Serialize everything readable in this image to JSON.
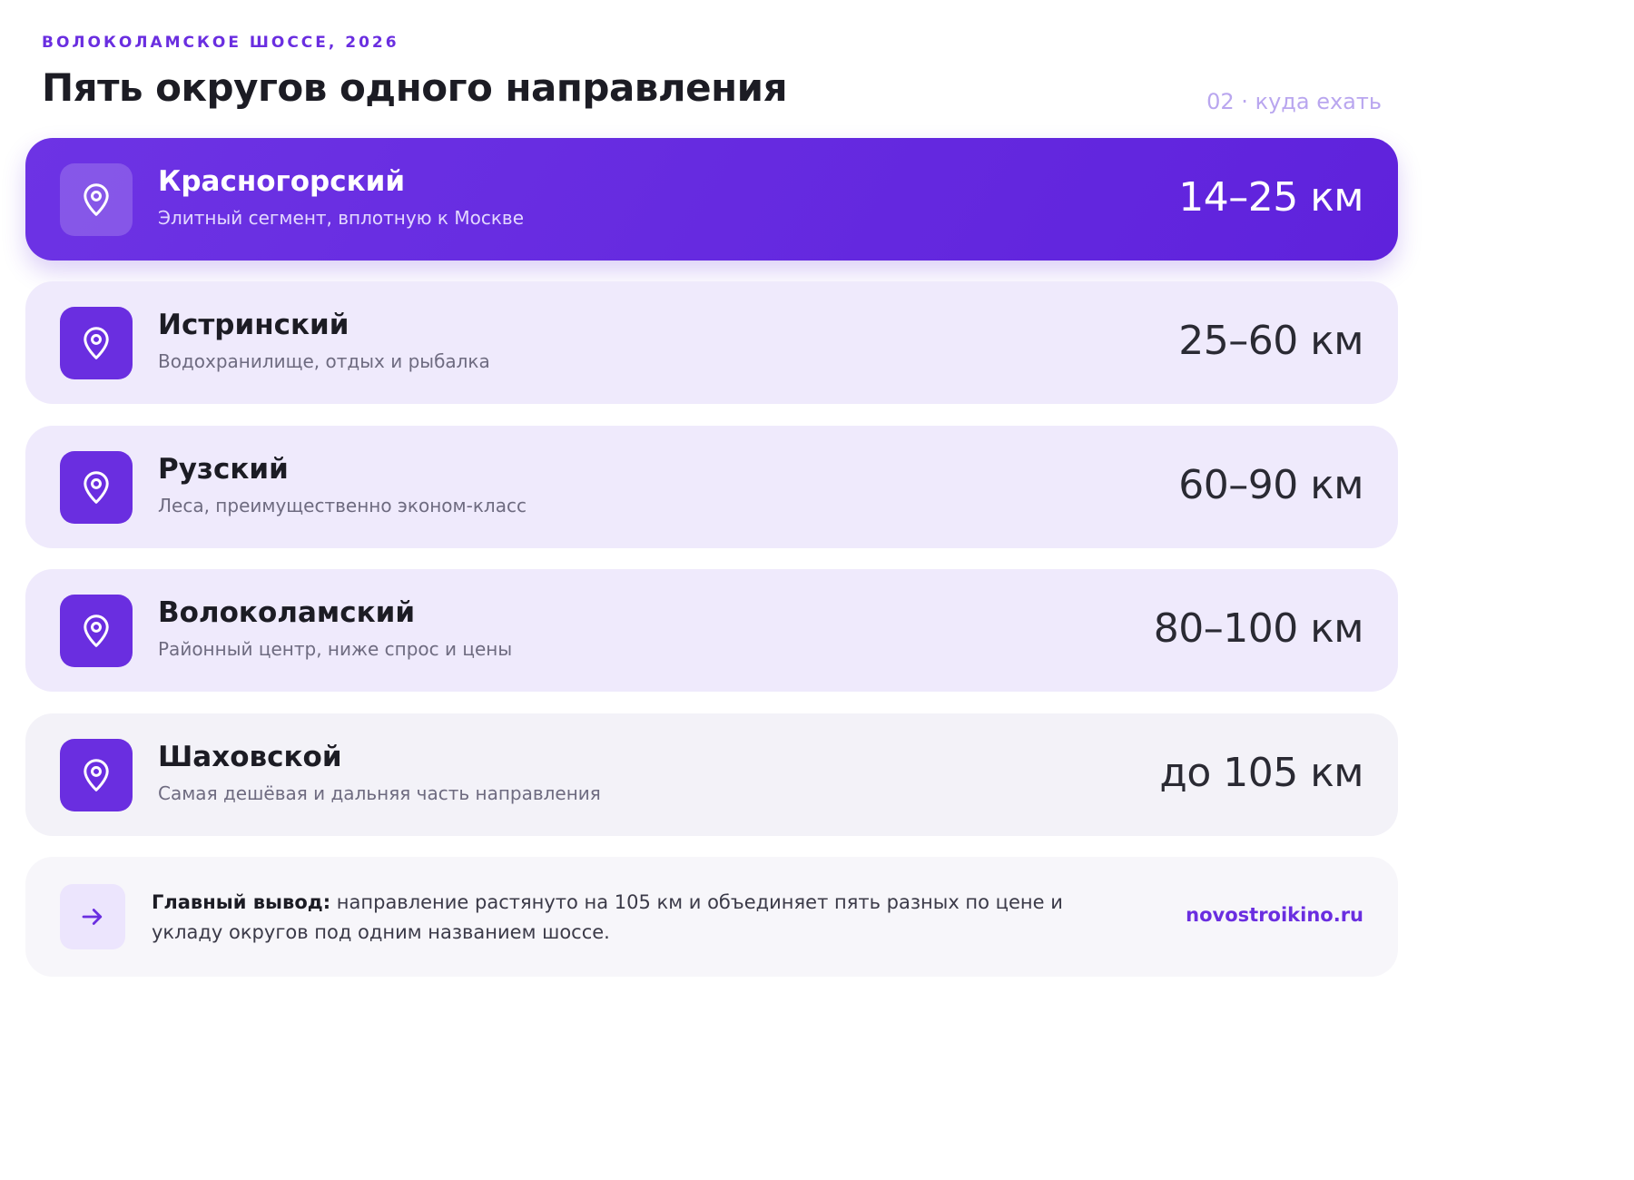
{
  "header": {
    "eyebrow": "ВОЛОКОЛАМСКОЕ ШОССЕ, 2026",
    "title": "Пять округов одного направления",
    "page_index": "02 · куда ехать"
  },
  "colors": {
    "accent": "#6a2ee0",
    "card_bg": "#efeafc",
    "muted_bg": "#f3f2f8",
    "index_text": "#b9a6ef"
  },
  "districts": [
    {
      "name": "Красногорский",
      "description": "Элитный сегмент, вплотную к Москве",
      "distance": "14–25 км",
      "icon": "map-pin-icon",
      "style": "accent"
    },
    {
      "name": "Истринский",
      "description": "Водохранилище, отдых и рыбалка",
      "distance": "25–60 км",
      "icon": "map-pin-icon",
      "style": "light"
    },
    {
      "name": "Рузский",
      "description": "Леса, преимущественно эконом-класс",
      "distance": "60–90 км",
      "icon": "map-pin-icon",
      "style": "light"
    },
    {
      "name": "Волоколамский",
      "description": "Районный центр, ниже спрос и цены",
      "distance": "80–100 км",
      "icon": "map-pin-icon",
      "style": "light"
    },
    {
      "name": "Шаховской",
      "description": "Самая дешёвая и дальняя часть направления",
      "distance": "до 105 км",
      "icon": "map-pin-icon",
      "style": "muted"
    }
  ],
  "summary": {
    "icon": "arrow-right-icon",
    "label": "Главный вывод:",
    "text": " направление растянуто на 105 км и объединяет пять разных по цене и укладу округов под одним названием шоссе.",
    "site": "novostroikino.ru"
  }
}
